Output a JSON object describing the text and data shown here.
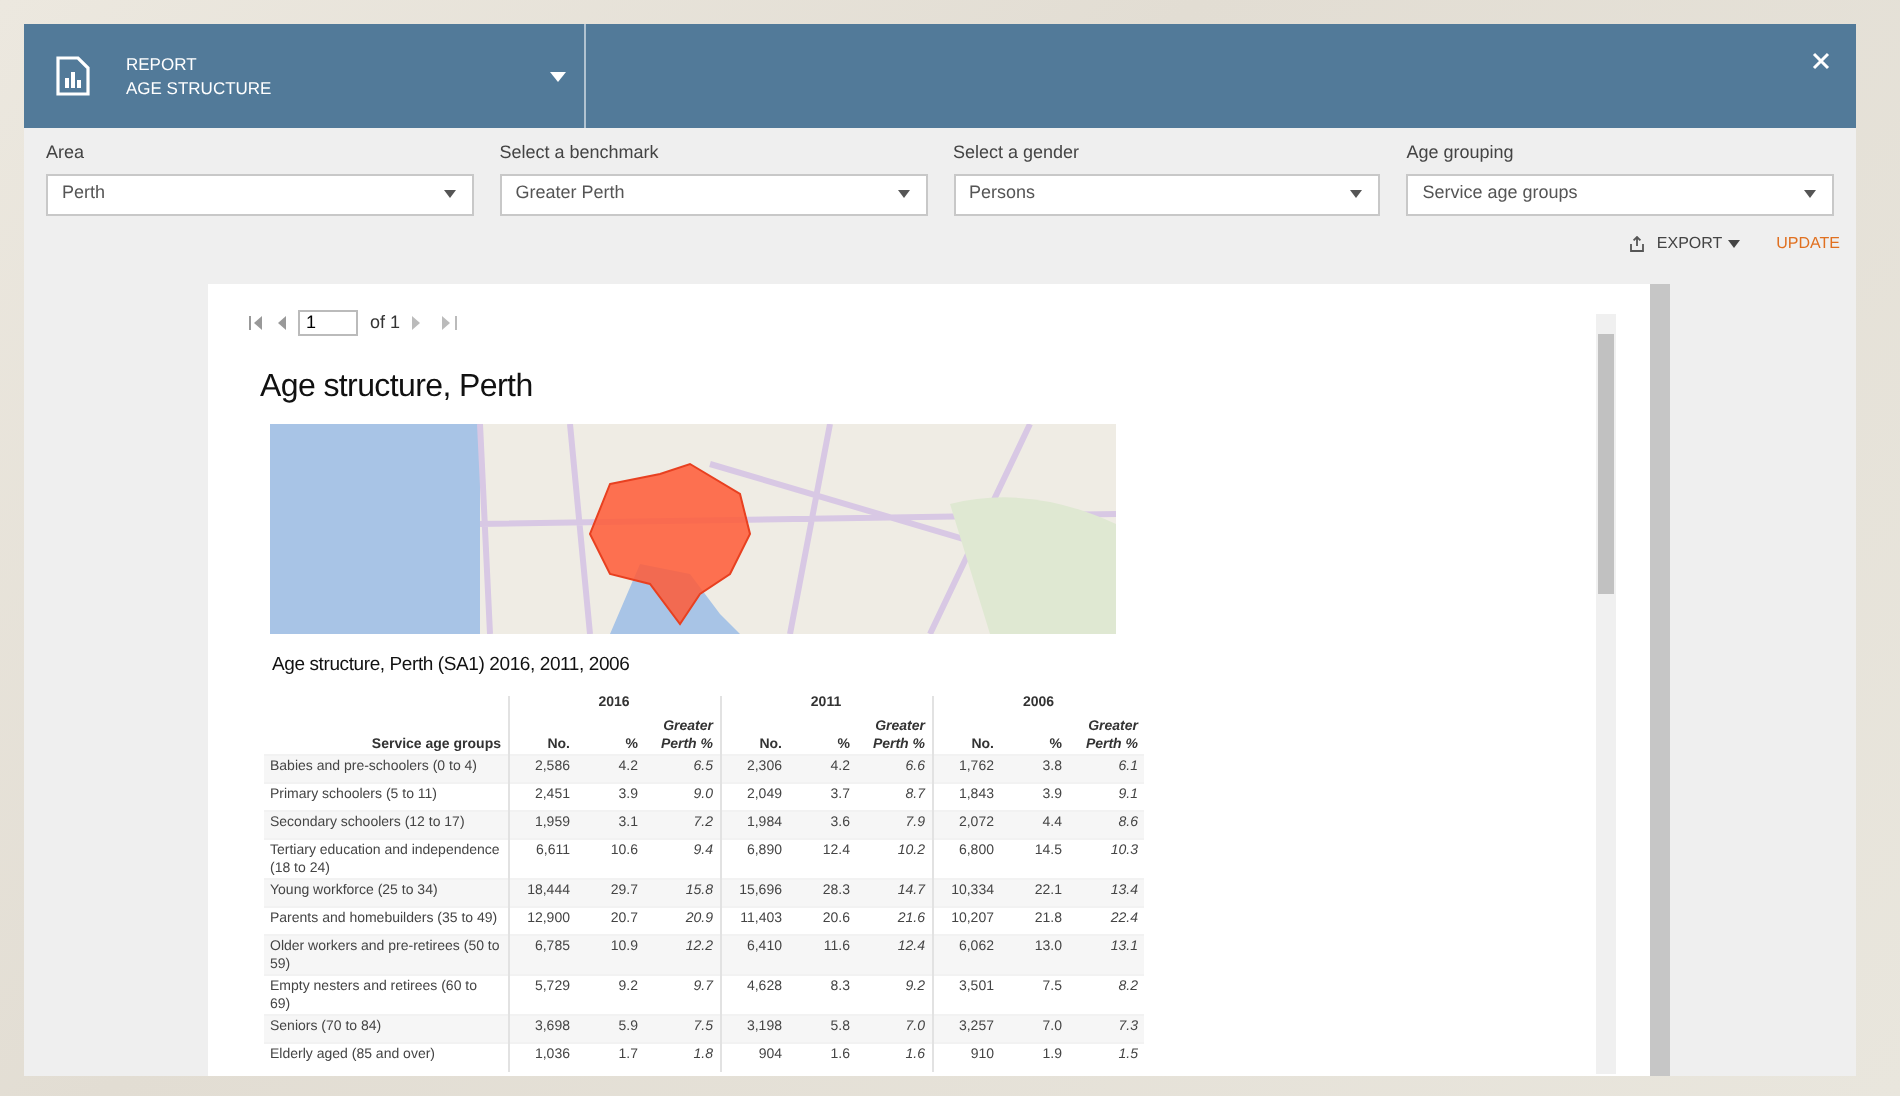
{
  "header": {
    "title_line_1": "REPORT",
    "title_line_2": "AGE STRUCTURE"
  },
  "filters": [
    {
      "label": "Area",
      "value": "Perth"
    },
    {
      "label": "Select a benchmark",
      "value": "Greater Perth"
    },
    {
      "label": "Select a gender",
      "value": "Persons"
    },
    {
      "label": "Age grouping",
      "value": "Service age groups"
    }
  ],
  "toolbar": {
    "export": "EXPORT",
    "update": "UPDATE"
  },
  "pager": {
    "page": "1",
    "of": "of 1"
  },
  "report": {
    "title": "Age structure, Perth",
    "table_title": "Age structure, Perth (SA1) 2016, 2011, 2006",
    "row_header": "Service age groups",
    "years": [
      {
        "year": "2016",
        "columns": [
          "No.",
          "%",
          "Greater Perth %"
        ]
      },
      {
        "year": "2011",
        "columns": [
          "No.",
          "%",
          "Greater Perth %"
        ]
      },
      {
        "year": "2006",
        "columns": [
          "No.",
          "%",
          "Greater Perth %"
        ]
      }
    ],
    "rows": [
      {
        "label": "Babies and pre-schoolers (0 to 4)",
        "values": [
          "2,586",
          "4.2",
          "6.5",
          "2,306",
          "4.2",
          "6.6",
          "1,762",
          "3.8",
          "6.1"
        ]
      },
      {
        "label": "Primary schoolers (5 to 11)",
        "values": [
          "2,451",
          "3.9",
          "9.0",
          "2,049",
          "3.7",
          "8.7",
          "1,843",
          "3.9",
          "9.1"
        ]
      },
      {
        "label": "Secondary schoolers (12 to 17)",
        "values": [
          "1,959",
          "3.1",
          "7.2",
          "1,984",
          "3.6",
          "7.9",
          "2,072",
          "4.4",
          "8.6"
        ]
      },
      {
        "label": "Tertiary education and independence (18 to 24)",
        "values": [
          "6,611",
          "10.6",
          "9.4",
          "6,890",
          "12.4",
          "10.2",
          "6,800",
          "14.5",
          "10.3"
        ]
      },
      {
        "label": "Young workforce (25 to 34)",
        "values": [
          "18,444",
          "29.7",
          "15.8",
          "15,696",
          "28.3",
          "14.7",
          "10,334",
          "22.1",
          "13.4"
        ]
      },
      {
        "label": "Parents and homebuilders (35 to 49)",
        "values": [
          "12,900",
          "20.7",
          "20.9",
          "11,403",
          "20.6",
          "21.6",
          "10,207",
          "21.8",
          "22.4"
        ]
      },
      {
        "label": "Older workers and pre-retirees (50 to 59)",
        "values": [
          "6,785",
          "10.9",
          "12.2",
          "6,410",
          "11.6",
          "12.4",
          "6,062",
          "13.0",
          "13.1"
        ]
      },
      {
        "label": "Empty nesters and retirees (60 to 69)",
        "values": [
          "5,729",
          "9.2",
          "9.7",
          "4,628",
          "8.3",
          "9.2",
          "3,501",
          "7.5",
          "8.2"
        ]
      },
      {
        "label": "Seniors (70 to 84)",
        "values": [
          "3,698",
          "5.9",
          "7.5",
          "3,198",
          "5.8",
          "7.0",
          "3,257",
          "7.0",
          "7.3"
        ]
      },
      {
        "label": "Elderly aged (85 and over)",
        "values": [
          "1,036",
          "1.7",
          "1.8",
          "904",
          "1.6",
          "1.6",
          "910",
          "1.9",
          "1.5"
        ]
      }
    ]
  }
}
